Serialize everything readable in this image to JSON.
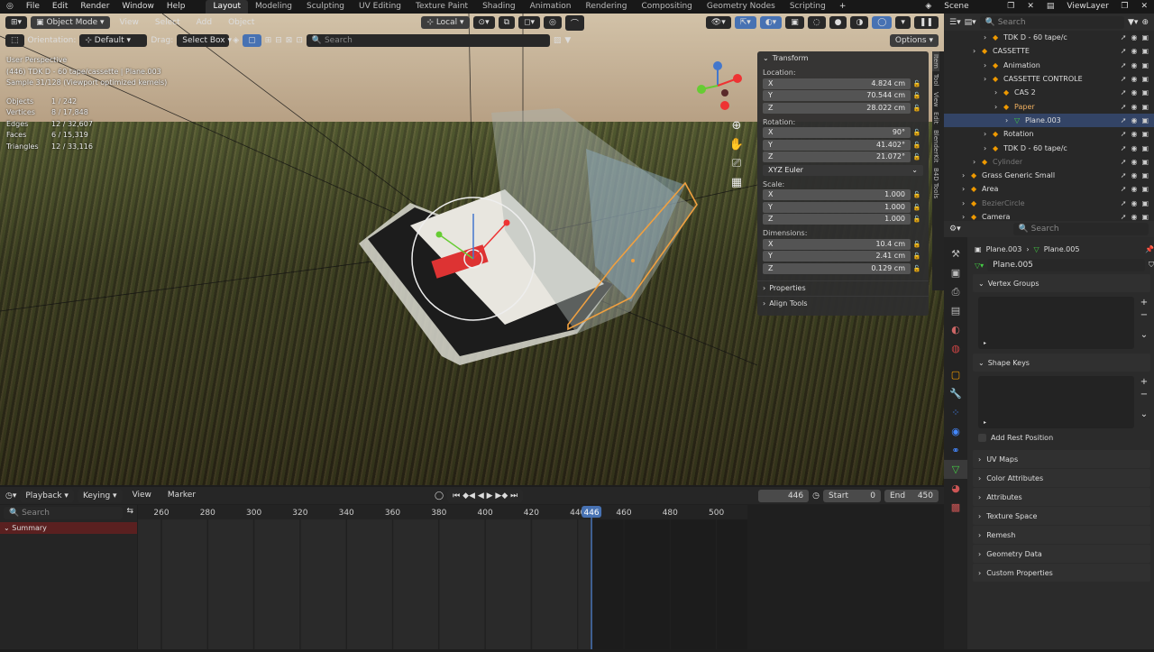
{
  "menus": [
    "File",
    "Edit",
    "Render",
    "Window",
    "Help"
  ],
  "workspaces": [
    "Layout",
    "Modeling",
    "Sculpting",
    "UV Editing",
    "Texture Paint",
    "Shading",
    "Animation",
    "Rendering",
    "Compositing",
    "Geometry Nodes",
    "Scripting"
  ],
  "scene": {
    "label": "Scene",
    "view_layer": "ViewLayer"
  },
  "viewport_header": {
    "mode": "Object Mode",
    "view": "View",
    "select": "Select",
    "add": "Add",
    "object": "Object",
    "transform_orientation": "Local"
  },
  "tool_header": {
    "orientation_label": "Orientation:",
    "orientation_value": "Default",
    "drag_label": "Drag:",
    "drag_value": "Select Box",
    "search_placeholder": "Search",
    "options": "Options"
  },
  "overlay_info": {
    "perspective": "User Perspective",
    "collection": "(446) TDK D - 60 tape/cassette | Plane.003",
    "sample": "Sample 31/128 (Viewport optimized kernels)",
    "stats": [
      {
        "label": "Objects",
        "value": "1 / 242"
      },
      {
        "label": "Vertices",
        "value": "8 / 17,848"
      },
      {
        "label": "Edges",
        "value": "12 / 32,607"
      },
      {
        "label": "Faces",
        "value": "6 / 15,319"
      },
      {
        "label": "Triangles",
        "value": "12 / 33,116"
      }
    ]
  },
  "transform": {
    "title": "Transform",
    "location_label": "Location:",
    "location": [
      {
        "axis": "X",
        "value": "4.824 cm"
      },
      {
        "axis": "Y",
        "value": "70.544 cm"
      },
      {
        "axis": "Z",
        "value": "28.022 cm"
      }
    ],
    "rotation_label": "Rotation:",
    "rotation": [
      {
        "axis": "X",
        "value": "90°"
      },
      {
        "axis": "Y",
        "value": "41.402°"
      },
      {
        "axis": "Z",
        "value": "21.072°"
      }
    ],
    "rotation_mode": "XYZ Euler",
    "scale_label": "Scale:",
    "scale": [
      {
        "axis": "X",
        "value": "1.000"
      },
      {
        "axis": "Y",
        "value": "1.000"
      },
      {
        "axis": "Z",
        "value": "1.000"
      }
    ],
    "dimensions_label": "Dimensions:",
    "dimensions": [
      {
        "axis": "X",
        "value": "10.4 cm"
      },
      {
        "axis": "Y",
        "value": "2.41 cm"
      },
      {
        "axis": "Z",
        "value": "0.129 cm"
      }
    ],
    "properties": "Properties",
    "align_tools": "Align Tools"
  },
  "sidebar_tabs": [
    "Item",
    "Tool",
    "View",
    "Edit",
    "BlenderKit",
    "B4D Tools"
  ],
  "timeline": {
    "playback": "Playback",
    "keying": "Keying",
    "view": "View",
    "marker": "Marker",
    "current_frame": "446",
    "start_label": "Start",
    "start": "0",
    "end_label": "End",
    "end": "450",
    "search_placeholder": "Search",
    "summary": "Summary",
    "ticks": [
      "260",
      "280",
      "300",
      "320",
      "340",
      "360",
      "380",
      "400",
      "420",
      "440",
      "460",
      "480",
      "500"
    ],
    "playhead": "446"
  },
  "outliner": {
    "search_placeholder": "Search",
    "rows": [
      {
        "label": "TDK D - 60 tape/c",
        "indent": 3,
        "color": "#ddd"
      },
      {
        "label": "CASSETTE",
        "indent": 2,
        "color": "#ddd"
      },
      {
        "label": "Animation",
        "indent": 3,
        "color": "#ddd"
      },
      {
        "label": "CASSETTE CONTROLE",
        "indent": 3,
        "color": "#ddd"
      },
      {
        "label": "CAS 2",
        "indent": 4,
        "color": "#ddd"
      },
      {
        "label": "Paper",
        "indent": 4,
        "color": "#f0b060"
      },
      {
        "label": "Plane.003",
        "indent": 5,
        "color": "#ddd"
      },
      {
        "label": "Rotation",
        "indent": 3,
        "color": "#ddd"
      },
      {
        "label": "TDK D - 60 tape/c",
        "indent": 3,
        "color": "#ddd"
      },
      {
        "label": "Cylinder",
        "indent": 2,
        "color": "#777"
      },
      {
        "label": "Grass Generic Small",
        "indent": 1,
        "color": "#ddd"
      },
      {
        "label": "Area",
        "indent": 1,
        "color": "#ddd"
      },
      {
        "label": "BezierCircle",
        "indent": 1,
        "color": "#777"
      },
      {
        "label": "Camera",
        "indent": 1,
        "color": "#ddd"
      }
    ]
  },
  "properties": {
    "search_placeholder": "Search",
    "breadcrumb_object": "Plane.003",
    "breadcrumb_data": "Plane.005",
    "datablock": "Plane.005",
    "vertex_groups": "Vertex Groups",
    "shape_keys": "Shape Keys",
    "add_rest_position": "Add Rest Position",
    "panels": [
      "UV Maps",
      "Color Attributes",
      "Attributes",
      "Texture Space",
      "Remesh",
      "Geometry Data",
      "Custom Properties"
    ]
  },
  "colors": {
    "accent": "#4772b3",
    "selection": "#f0a040",
    "active_tab": "#303030"
  }
}
